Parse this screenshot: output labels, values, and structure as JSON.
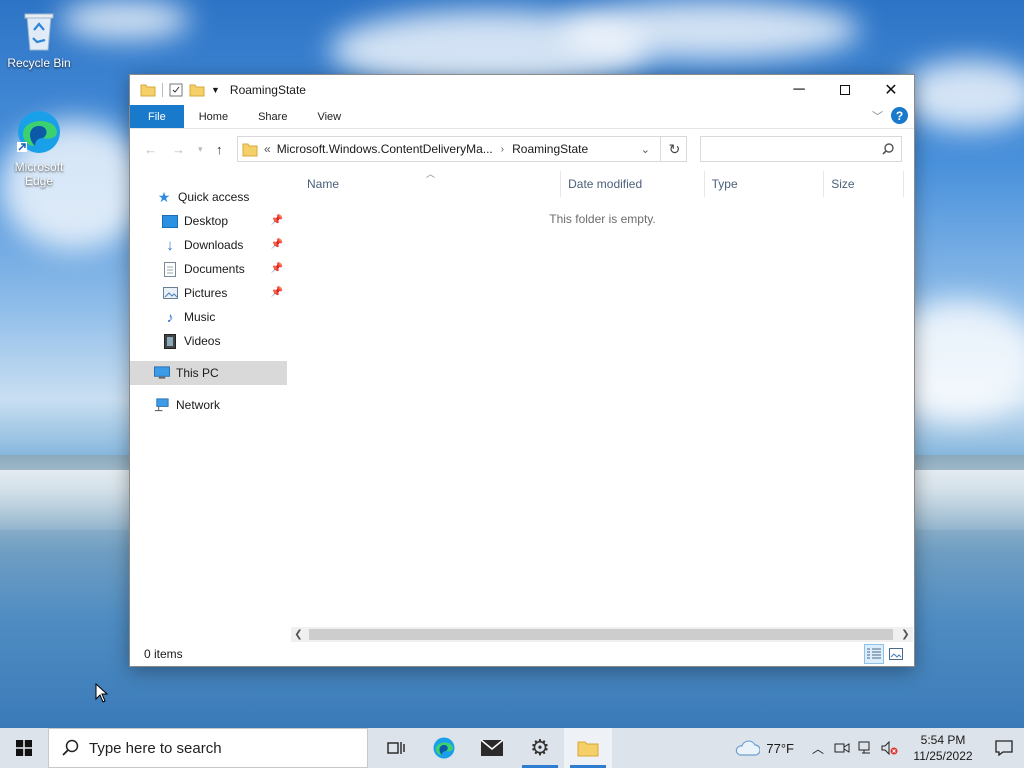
{
  "desktop": {
    "icons": [
      {
        "label": "Recycle Bin",
        "icon": "recycle-bin-icon"
      },
      {
        "label": "Microsoft Edge",
        "icon": "edge-icon"
      }
    ]
  },
  "window": {
    "title": "RoamingState",
    "ribbon_tabs": [
      "File",
      "Home",
      "Share",
      "View"
    ],
    "address": {
      "overflow": "«",
      "segments": [
        "Microsoft.Windows.ContentDeliveryMa...",
        "RoamingState"
      ]
    },
    "search": {
      "value": "",
      "placeholder": ""
    },
    "nav": {
      "quick_access": "Quick access",
      "items": [
        {
          "label": "Desktop",
          "pinned": true
        },
        {
          "label": "Downloads",
          "pinned": true
        },
        {
          "label": "Documents",
          "pinned": true
        },
        {
          "label": "Pictures",
          "pinned": true
        },
        {
          "label": "Music",
          "pinned": false
        },
        {
          "label": "Videos",
          "pinned": false
        }
      ],
      "this_pc": "This PC",
      "network": "Network"
    },
    "columns": [
      "Name",
      "Date modified",
      "Type",
      "Size"
    ],
    "empty_message": "This folder is empty.",
    "status": "0 items"
  },
  "taskbar": {
    "search_placeholder": "Type here to search",
    "weather": "77°F",
    "time": "5:54 PM",
    "date": "11/25/2022"
  },
  "colors": {
    "accent": "#1979ca",
    "taskbar": "#dde3ea"
  }
}
